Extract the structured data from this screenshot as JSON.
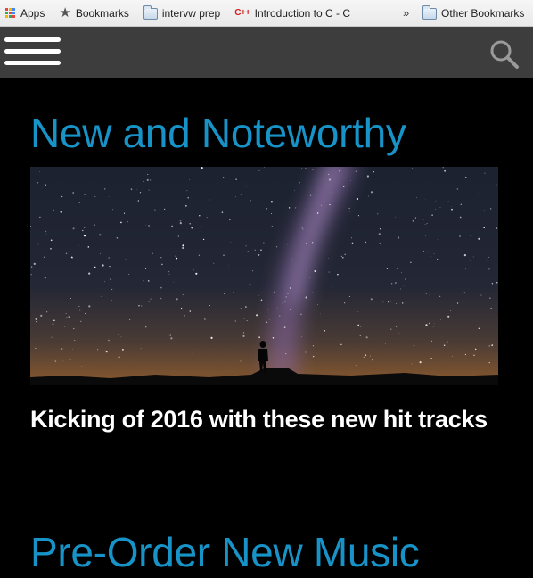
{
  "bookmarks_bar": {
    "items": [
      {
        "label": "Apps",
        "icon": "apps-grid-icon"
      },
      {
        "label": "Bookmarks",
        "icon": "star-icon"
      },
      {
        "label": "intervw prep",
        "icon": "folder-icon"
      },
      {
        "label": "Introduction to C - C",
        "icon": "cpp-icon",
        "icon_text": "C++"
      }
    ],
    "overflow_symbol": "»",
    "other_bookmarks": {
      "label": "Other Bookmarks",
      "icon": "folder-icon"
    }
  },
  "header": {
    "menu_icon": "hamburger-menu-icon",
    "search_icon": "search-icon"
  },
  "main": {
    "sections": [
      {
        "heading": "New and Noteworthy",
        "feature": {
          "image": "starry-night-sky-with-silhouette",
          "title": "Kicking of 2016 with these new hit tracks"
        }
      },
      {
        "heading": "Pre-Order New Music"
      }
    ]
  },
  "colors": {
    "accent": "#1793c8",
    "header_bg": "#3d3d3d",
    "page_bg": "#000000",
    "bookmarks_bar_bg": "#eeeeee"
  }
}
